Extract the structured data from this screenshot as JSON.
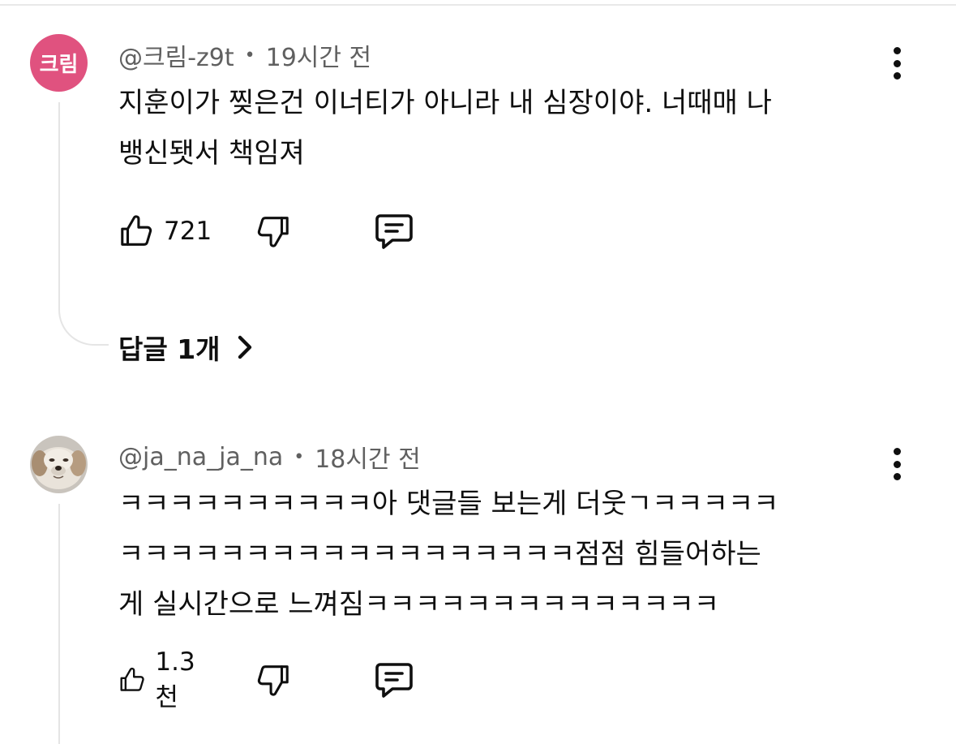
{
  "comments": [
    {
      "avatar_text": "크림",
      "avatar_color": "#e0527f",
      "author": "@크림-z9t",
      "separator": "•",
      "time": "19시간 전",
      "text": "지훈이가 찢은건 이너티가 아니라 내 심장이야. 너때매 나\n뱅신됏서 책임져",
      "likes": "721",
      "replies_label": "답글 1개"
    },
    {
      "avatar_icon": "dog-photo",
      "author": "@ja_na_ja_na",
      "separator": "•",
      "time": "18시간 전",
      "text": "ㅋㅋㅋㅋㅋㅋㅋㅋㅋㅋ아 댓글들 보는게 더웃ㄱㅋㅋㅋㅋㅋ\nㅋㅋㅋㅋㅋㅋㅋㅋㅋㅋㅋㅋㅋㅋㅋㅋㅋㅋ점점 힘들어하는\n게 실시간으로 느껴짐ㅋㅋㅋㅋㅋㅋㅋㅋㅋㅋㅋㅋㅋㅋ",
      "likes": "1.3천"
    }
  ],
  "icons": {
    "like": "thumbs-up-icon",
    "dislike": "thumbs-down-icon",
    "reply": "reply-comment-icon",
    "more": "more-vertical-icon",
    "chevron": "chevron-right-icon"
  }
}
